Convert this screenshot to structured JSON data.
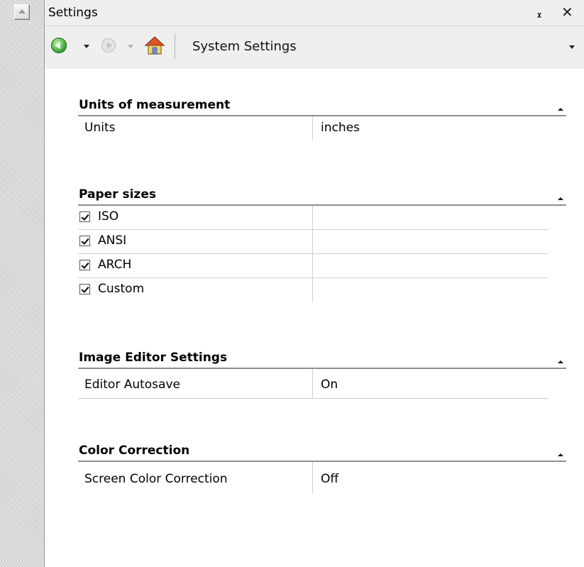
{
  "window": {
    "title": "Settings"
  },
  "toolbar": {
    "back_icon": "back-arrow-icon",
    "forward_icon": "forward-arrow-icon",
    "home_icon": "home-icon",
    "location": "System Settings"
  },
  "sections": {
    "units": {
      "title": "Units of measurement",
      "rows": [
        {
          "label": "Units",
          "value": "inches"
        }
      ]
    },
    "paper": {
      "title": "Paper sizes",
      "options": [
        {
          "label": "ISO",
          "checked": true
        },
        {
          "label": "ANSI",
          "checked": true
        },
        {
          "label": "ARCH",
          "checked": true
        },
        {
          "label": "Custom",
          "checked": true
        }
      ]
    },
    "image_editor": {
      "title": "Image Editor Settings",
      "rows": [
        {
          "label": "Editor Autosave",
          "value": "On"
        }
      ]
    },
    "color": {
      "title": "Color Correction",
      "rows": [
        {
          "label": "Screen Color Correction",
          "value": "Off"
        }
      ]
    }
  },
  "colors": {
    "chrome": "#efefef",
    "divider": "#cfcfcf",
    "header_rule": "#8e8e8e"
  }
}
